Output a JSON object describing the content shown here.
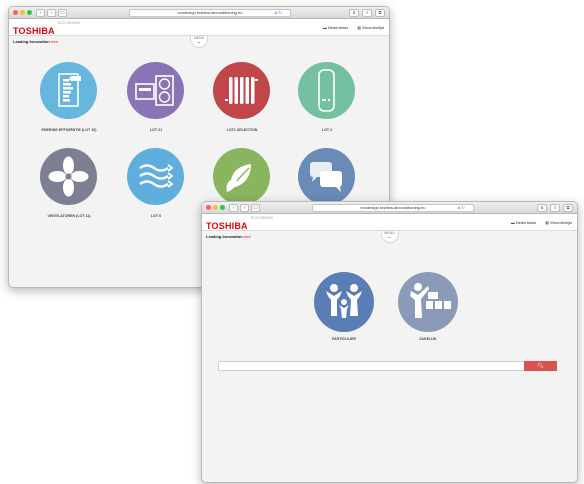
{
  "window1": {
    "url": "ecodesign.toshiba-airconditioning.eu",
    "brand": "TOSHIBA",
    "eco_label": "ECO DESIGN",
    "tagline": "Leading Innovation",
    "tag_arrow": ">>>",
    "menu_label": "MENU",
    "languages": [
      "Nederlands",
      "Woordenlijst"
    ],
    "categories": [
      {
        "label": "ENERGIE-EFFICIËNTIE (LOT 10)",
        "icon": "energy-label-icon",
        "color": "#66b6de"
      },
      {
        "label": "LOT 21",
        "icon": "heat-pump-unit-icon",
        "color": "#8a74b6"
      },
      {
        "label": "LOT1 SELECTION",
        "icon": "radiator-icon",
        "color": "#c0464a"
      },
      {
        "label": "LOT 2",
        "icon": "water-heater-icon",
        "color": "#76c0a2"
      },
      {
        "label": "VENTILATOREN (LOT 11)",
        "icon": "fan-icon",
        "color": "#7d7f93"
      },
      {
        "label": "LOT 6",
        "icon": "air-waves-icon",
        "color": "#5faedd"
      },
      {
        "label": "",
        "icon": "leaves-icon",
        "color": "#8ab55f"
      },
      {
        "label": "",
        "icon": "chat-bubbles-icon",
        "color": "#6a8ab8"
      }
    ]
  },
  "window2": {
    "url": "ecodesign.toshiba-airconditioning.eu",
    "brand": "TOSHIBA",
    "eco_label": "ECO DESIGN",
    "tagline": "Leading Innovation",
    "tag_arrow": ">>>",
    "menu_label": "MENU",
    "languages": [
      "Nederlands",
      "Woordenlijst"
    ],
    "choices": [
      {
        "label": "PARTICULIER",
        "icon": "family-icon",
        "color": "#5b7db5"
      },
      {
        "label": "ZAKELIJK",
        "icon": "business-icon",
        "color": "#8a9ab8"
      }
    ],
    "search_placeholder": "",
    "search_button_icon": "search-icon"
  }
}
